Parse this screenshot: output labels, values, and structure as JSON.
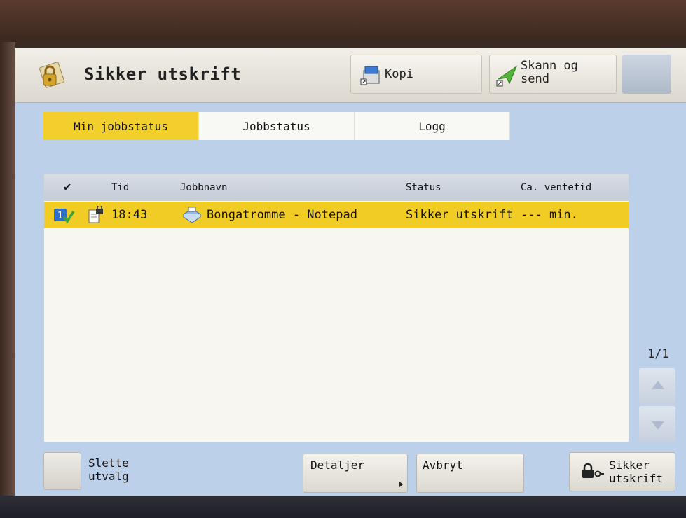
{
  "header": {
    "title": "Sikker utskrift",
    "buttons": [
      {
        "label": "Kopi",
        "icon": "copy-icon"
      },
      {
        "label": "Skann og send",
        "icon": "send-icon"
      }
    ]
  },
  "tabs": [
    {
      "label": "Min jobbstatus",
      "active": true
    },
    {
      "label": "Jobbstatus",
      "active": false
    },
    {
      "label": "Logg",
      "active": false
    }
  ],
  "table": {
    "columns": [
      "Tid",
      "Jobbnavn",
      "Status",
      "Ca. ventetid"
    ],
    "rows": [
      {
        "index": "1",
        "time": "18:43",
        "job_name": "Bongatromme - Notepad",
        "status": "Sikker utskrift",
        "wait": "--- min."
      }
    ]
  },
  "pager": {
    "text": "1/1"
  },
  "footer": {
    "select_label": "Slette utvalg",
    "details_label": "Detaljer",
    "cancel_label": "Avbryt",
    "secure_print_label": "Sikker utskrift"
  },
  "colors": {
    "accent": "#f2cf2c",
    "screen_bg": "#bcd0ea"
  }
}
